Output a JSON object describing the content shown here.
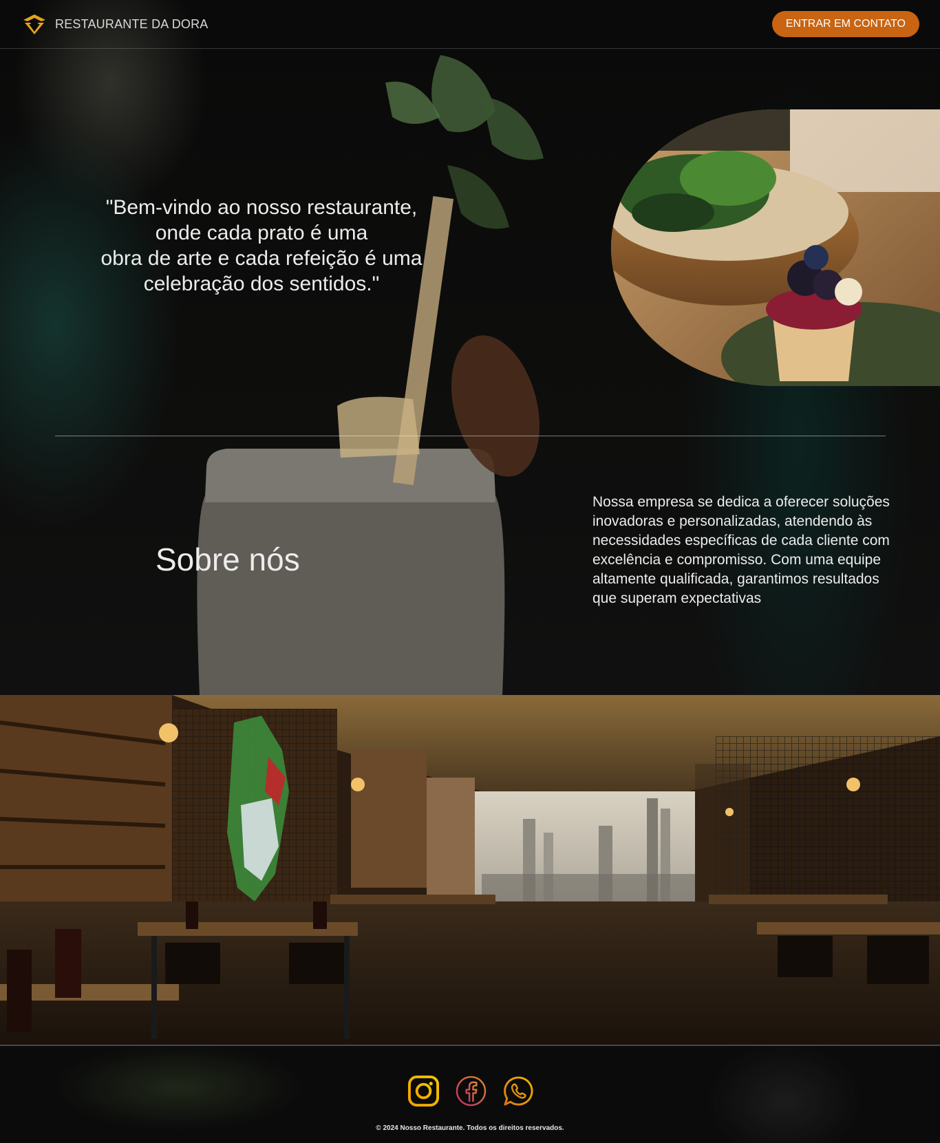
{
  "header": {
    "brand_name": "RESTAURANTE DA DORA",
    "cta_label": "ENTRAR EM CONTATO"
  },
  "hero": {
    "quote_lines": [
      "\"Bem-vindo ao nosso restaurante,",
      "onde cada prato é uma",
      "obra de arte e cada refeição é uma",
      "celebração dos sentidos.\""
    ]
  },
  "about": {
    "title": "Sobre nós",
    "text": "Nossa empresa se dedica a oferecer soluções inovadoras e personalizadas, atendendo às necessidades específicas de cada cliente com excelência e compromisso. Com uma equipe altamente qualificada, garantimos resultados que superam expectativas"
  },
  "footer": {
    "social_icons": [
      "instagram-icon",
      "facebook-icon",
      "whatsapp-icon"
    ],
    "copyright": "© 2024 Nosso Restaurante. Todos os direitos reservados."
  },
  "colors": {
    "accent": "#c86412",
    "gold": "#e8a21c",
    "background": "#0b0b0b"
  }
}
